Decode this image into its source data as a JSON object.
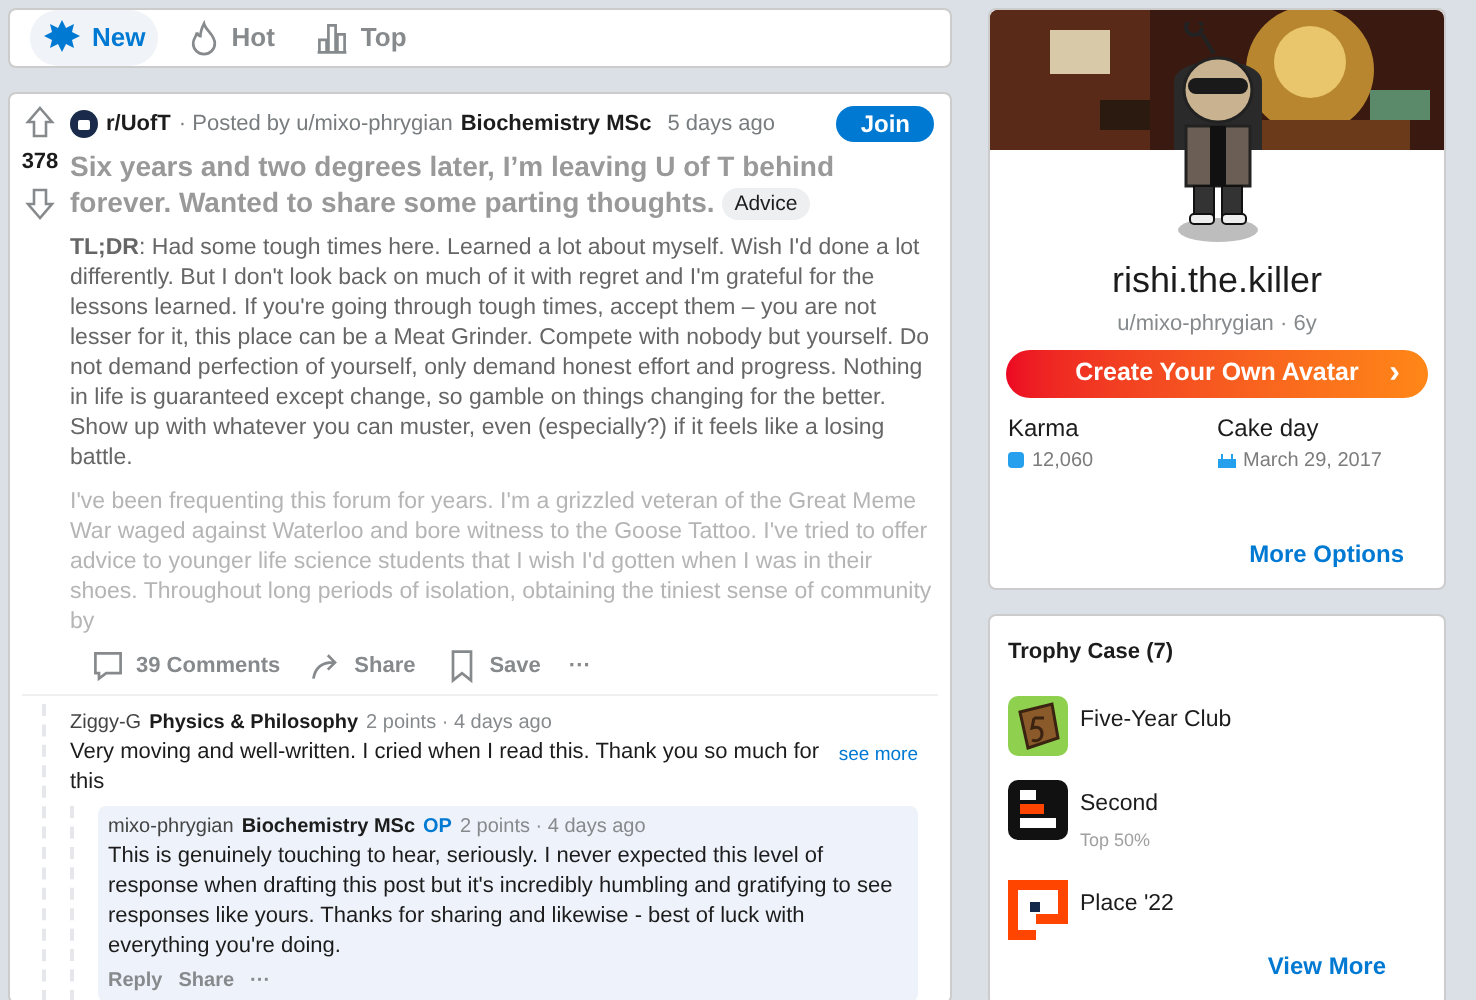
{
  "sort_tabs": [
    {
      "label": "New",
      "selected": true,
      "kind": "new"
    },
    {
      "label": "Hot",
      "selected": false,
      "kind": "hot"
    },
    {
      "label": "Top",
      "selected": false,
      "kind": "top"
    }
  ],
  "post": {
    "subreddit": "r/UofT",
    "posted_by": "· Posted by u/mixo-phrygian",
    "flair": "Biochemistry MSc",
    "time": "5 days ago",
    "join": "Join",
    "votes": "378",
    "title": "Six years and two degrees later, I’m leaving U of T behind forever. Wanted to share some parting thoughts.",
    "tag": "Advice",
    "body": [
      "**TL;DR**: Had some tough times here. Learned a lot about myself. Wish I'd done a lot differently. But I don't look back on much of it with regret and I'm grateful for the lessons learned. If you're going through tough times, accept them – you are not lesser for it, this place can be a Meat Grinder. Compete with nobody but yourself. Do not demand perfection of yourself, only demand honest effort and progress. Nothing in life is guaranteed except change, so gamble on things changing for the better. Show up with whatever you can muster, even (especially?) if it feels like a losing battle.",
      "I've been frequenting this forum for years. I'm a grizzled veteran of the Great Meme War waged against Waterloo and bore witness to the Goose Tattoo. I've tried to offer advice to younger life science students that I wish I'd gotten when I was in their shoes. Throughout long periods of isolation, obtaining the tiniest sense of community by"
    ],
    "actions": [
      {
        "kind": "comments",
        "label": "39 Comments"
      },
      {
        "kind": "share",
        "label": "Share"
      },
      {
        "kind": "save",
        "label": "Save"
      },
      {
        "kind": "more",
        "label": "···"
      }
    ]
  },
  "comments": [
    {
      "author": "Ziggy-G",
      "flair": "Physics & Philosophy",
      "op": false,
      "meta": "2 points · 4 days ago",
      "text": "Very moving and well-written. I cried when I read this. Thank you so much for this",
      "see_more": "see more",
      "highlighted": false,
      "children": [
        {
          "author": "mixo-phrygian",
          "flair": "Biochemistry MSc",
          "op": true,
          "op_label": "OP",
          "meta": "2 points · 4 days ago",
          "text": "This is genuinely touching to hear, seriously. I never expected this level of response when drafting this post but it's incredibly humbling and gratifying to see responses like yours. Thanks for sharing and likewise - best of luck with everything you're doing.",
          "highlighted": true,
          "actions": [
            "Reply",
            "Share",
            "···"
          ]
        }
      ]
    }
  ],
  "profile": {
    "display_name": "rishi.the.killer",
    "handle": "u/mixo-phrygian · 6y",
    "create_avatar": "Create Your Own Avatar",
    "create_avatar_arrow": "›",
    "karma_label": "Karma",
    "karma": "12,060",
    "cakeday_label": "Cake day",
    "cakeday": "March 29, 2017",
    "more_options": "More Options"
  },
  "trophies": {
    "title": "Trophy Case (7)",
    "items": [
      {
        "kind": "five-year",
        "name": "Five-Year Club"
      },
      {
        "kind": "second",
        "name": "Second",
        "subtitle": "Top 50%"
      },
      {
        "kind": "place",
        "name": "Place '22"
      }
    ],
    "view_more": "View More"
  }
}
